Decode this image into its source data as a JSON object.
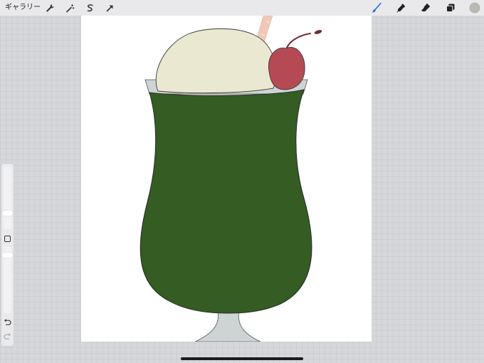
{
  "topbar": {
    "gallery_label": "ギャラリー",
    "left_tools": [
      "wrench-icon",
      "magic-wand-icon",
      "selection-icon",
      "transform-arrow-icon"
    ],
    "right_tools": [
      "brush-icon",
      "smudge-icon",
      "eraser-icon",
      "layers-icon",
      "color-swatch"
    ],
    "active_tool": "brush",
    "colors": {
      "active_tool": "#2f6fd6",
      "current_color": "#b8bab6"
    }
  },
  "sidebar": {
    "brush_size_level": 0.24,
    "opacity_level": 0.9,
    "modifier_icon": "square-modifier-icon",
    "undo_icon": "undo-icon",
    "redo_icon": "redo-icon"
  },
  "artwork": {
    "subject": "melon-cream-soda",
    "colors": {
      "drink": "#345c23",
      "ice_cream": "#ebe8d1",
      "cherry": "#b64a54",
      "cherry_stem": "#7a2a33",
      "straw": "#efc8b8",
      "glass": "#ced3d3",
      "outline": "#2a2a2a"
    }
  }
}
